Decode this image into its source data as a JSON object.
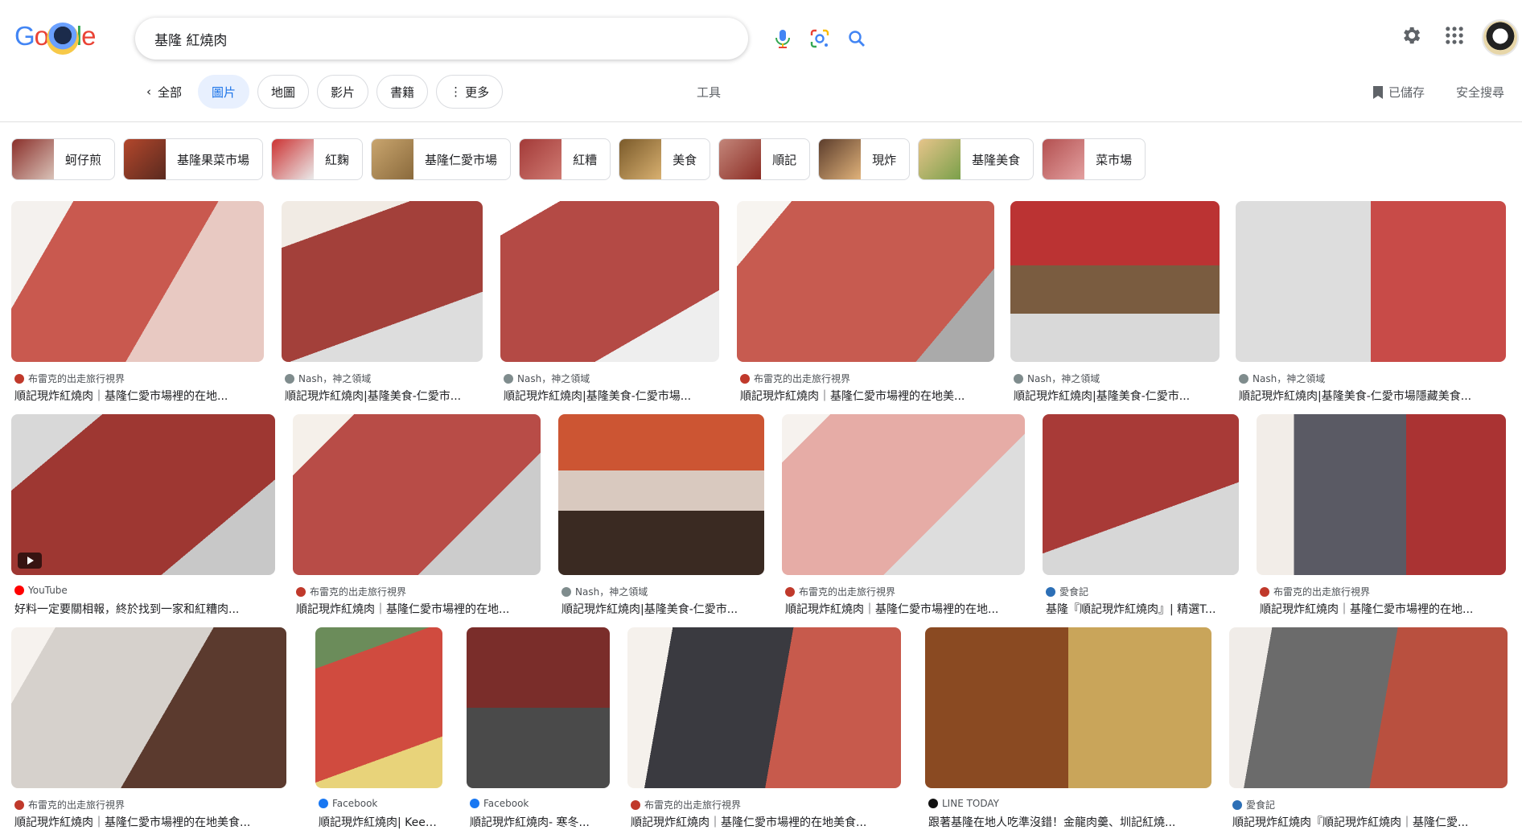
{
  "header": {
    "logo_text": "Google",
    "search_value": "基隆 紅燒肉",
    "icons": [
      "mic-icon",
      "lens-icon",
      "search-icon",
      "gear-icon",
      "apps-icon"
    ]
  },
  "tabs": {
    "back_label": "全部",
    "items": [
      "圖片",
      "地圖",
      "影片",
      "書籍",
      "更多"
    ],
    "active": "圖片",
    "tools_label": "工具",
    "saved_label": "已儲存",
    "safe_search_label": "安全搜尋"
  },
  "chips": [
    "蚵仔煎",
    "基隆果菜市場",
    "紅麴",
    "基隆仁愛市場",
    "紅糟",
    "美食",
    "順記",
    "現炸",
    "基隆美食",
    "菜市場"
  ],
  "results": [
    {
      "source": "布雷克的出走旅行視界",
      "title": "順記現炸紅燒肉｜基隆仁愛市場裡的在地..."
    },
    {
      "source": "Nash，神之領域",
      "title": "順記現炸紅燒肉|基隆美食-仁愛市..."
    },
    {
      "source": "Nash，神之領域",
      "title": "順記現炸紅燒肉|基隆美食-仁愛市場..."
    },
    {
      "source": "布雷克的出走旅行視界",
      "title": "順記現炸紅燒肉｜基隆仁愛市場裡的在地美..."
    },
    {
      "source": "Nash，神之領域",
      "title": "順記現炸紅燒肉|基隆美食-仁愛市..."
    },
    {
      "source": "Nash，神之領域",
      "title": "順記現炸紅燒肉|基隆美食-仁愛市場隱藏美食..."
    },
    {
      "source": "YouTube",
      "title": "好料一定要關相報，終於找到一家和紅糟肉..."
    },
    {
      "source": "布雷克的出走旅行視界",
      "title": "順記現炸紅燒肉｜基隆仁愛市場裡的在地..."
    },
    {
      "source": "Nash，神之領域",
      "title": "順記現炸紅燒肉|基隆美食-仁愛市..."
    },
    {
      "source": "布雷克的出走旅行視界",
      "title": "順記現炸紅燒肉｜基隆仁愛市場裡的在地..."
    },
    {
      "source": "愛食記",
      "title": "基隆『順記現炸紅燒肉』| 精選T..."
    },
    {
      "source": "布雷克的出走旅行視界",
      "title": "順記現炸紅燒肉｜基隆仁愛市場裡的在地..."
    },
    {
      "source": "布雷克的出走旅行視界",
      "title": "順記現炸紅燒肉｜基隆仁愛市場裡的在地美食..."
    },
    {
      "source": "Facebook",
      "title": "順記現炸紅燒肉| Keelu..."
    },
    {
      "source": "Facebook",
      "title": "順記現炸紅燒肉- 寒冬..."
    },
    {
      "source": "布雷克的出走旅行視界",
      "title": "順記現炸紅燒肉｜基隆仁愛市場裡的在地美食..."
    },
    {
      "source": "LINE TODAY",
      "title": "跟著基隆在地人吃準沒錯！金龍肉羹、圳記紅燒..."
    },
    {
      "source": "愛食記",
      "title": "順記現炸紅燒肉『順記現炸紅燒肉｜基隆仁愛..."
    }
  ]
}
